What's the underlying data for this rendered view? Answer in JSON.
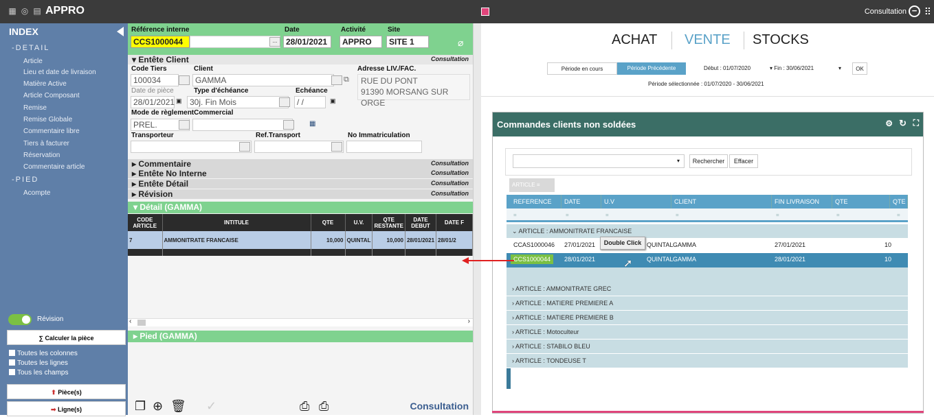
{
  "titlebar": {
    "title": "APPRO",
    "mode": "Consultation"
  },
  "sidebar": {
    "index": "INDEX",
    "detail_label": "DETAIL",
    "items": [
      "Article",
      "Lieu et date de livraison",
      "Matière Active",
      "Article Composant",
      "Remise",
      "Remise Globale",
      "Commentaire libre",
      "Tiers à facturer",
      "Réservation",
      "Commentaire article"
    ],
    "pied_label": "PIED",
    "pied_items": [
      "Acompte"
    ],
    "revision": "Révision",
    "calc": "Calculer la pièce",
    "checks": [
      "Toutes les colonnes",
      "Toutes les lignes",
      "Tous les champs"
    ],
    "piece_btn": "Pièce(s)",
    "ligne_btn": "Ligne(s)"
  },
  "header": {
    "ref_label": "Référence interne",
    "ref_value": "CCS1000044",
    "date_label": "Date",
    "date_value": "28/01/2021",
    "activite_label": "Activité",
    "activite_value": "APPRO",
    "site_label": "Site",
    "site_value": "SITE 1"
  },
  "entete": {
    "title": "Entête Client",
    "consultation": "Consultation",
    "code_tiers_label": "Code Tiers",
    "code_tiers": "100034",
    "client_label": "Client",
    "client": "GAMMA",
    "adresse_label": "Adresse LIV./FAC.",
    "adresse1": "RUE DU PONT",
    "adresse2": "91390  MORSANG SUR ORGE",
    "date_piece_label": "Date de pièce",
    "date_piece": "28/01/2021",
    "type_ech_label": "Type d'échéance",
    "type_ech": "30j. Fin Mois",
    "echeance_label": "Echéance",
    "echeance": "/ /",
    "mode_reg_label": "Mode de règlement",
    "commercial_label": "Commercial",
    "mode_reg": "PREL.",
    "transporteur_label": "Transporteur",
    "ref_transport_label": "Ref.Transport",
    "immat_label": "No Immatriculation"
  },
  "sections": [
    {
      "name": "Commentaire",
      "status": "Consultation"
    },
    {
      "name": "Entête No Interne",
      "status": "Consultation"
    },
    {
      "name": "Entête Détail",
      "status": "Consultation"
    },
    {
      "name": "Révision",
      "status": "Consultation"
    }
  ],
  "detail": {
    "title": "Détail (GAMMA)",
    "columns": [
      "CODE ARTICLE",
      "INTITULE",
      "QTE",
      "U.V.",
      "QTE RESTANTE",
      "DATE DEBUT",
      "DATE F"
    ],
    "rows": [
      [
        "7",
        "AMMONITRATE FRANCAISE",
        "10,000",
        "QUINTAL",
        "10,000",
        "28/01/2021",
        "28/01/2"
      ]
    ]
  },
  "pied": {
    "title": "Pied (GAMMA)"
  },
  "footer": {
    "consultation": "Consultation"
  },
  "right": {
    "tabs": [
      "ACHAT",
      "VENTE",
      "STOCKS"
    ],
    "periode_cours": "Période en cours",
    "periode_prec": "Période Précédente",
    "debut": "Début : 01/07/2020",
    "fin": "Fin : 30/06/2021",
    "ok": "OK",
    "selection": "Période sélectionnée : 01/07/2020 - 30/06/2021",
    "panel_title": "Commandes clients non soldées",
    "rechercher": "Rechercher",
    "effacer": "Effacer",
    "group_chip": "ARTICLE",
    "columns": [
      "REFERENCE",
      "DATE",
      "U.V",
      "CLIENT",
      "FIN LIVRAISON",
      "QTE COMMANDEE",
      "QTE"
    ],
    "group_open": "ARTICLE : AMMONITRATE FRANCAISE",
    "rows": [
      [
        "CCAS1000046",
        "27/01/2021",
        "QUINTAL",
        "GAMMA",
        "27/01/2021",
        "10"
      ],
      [
        "CCS1000044",
        "28/01/2021",
        "QUINTAL",
        "GAMMA",
        "28/01/2021",
        "10"
      ]
    ],
    "tooltip": "Double Click",
    "groups": [
      "ARTICLE : AMMONITRATE GREC",
      "ARTICLE : MATIERE PREMIERE A",
      "ARTICLE : MATIERE PREMIERE B",
      "ARTICLE : Motoculteur",
      "ARTICLE : STABILO BLEU",
      "ARTICLE : TONDEUSE T"
    ]
  }
}
